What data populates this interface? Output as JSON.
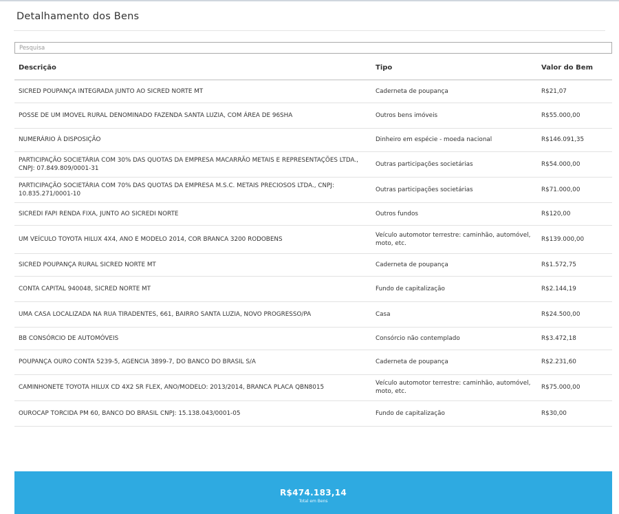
{
  "page": {
    "title": "Detalhamento dos Bens"
  },
  "search": {
    "placeholder": "Pesquisa"
  },
  "table": {
    "headers": [
      "Descrição",
      "Tipo",
      "Valor do Bem"
    ],
    "rows": [
      {
        "descricao": "SICRED POUPANÇA INTEGRADA JUNTO AO SICRED NORTE MT",
        "tipo": "Caderneta de poupança",
        "valor": "R$21,07"
      },
      {
        "descricao": "POSSE DE UM IMOVEL RURAL DENOMINADO FAZENDA SANTA LUZIA, COM ÁREA DE 96SHA",
        "tipo": "Outros bens imóveis",
        "valor": "R$55.000,00"
      },
      {
        "descricao": "NUMERÁRIO À DISPOSIÇÃO",
        "tipo": "Dinheiro em espécie - moeda nacional",
        "valor": "R$146.091,35"
      },
      {
        "descricao": "PARTICIPAÇÃO SOCIETÁRIA COM 30% DAS QUOTAS DA EMPRESA MACARRÃO METAIS E REPRESENTAÇÕES LTDA., CNPJ: 07.849.809/0001-31",
        "tipo": "Outras participações societárias",
        "valor": "R$54.000,00"
      },
      {
        "descricao": "PARTICIPAÇÃO SOCIETÁRIA COM 70% DAS QUOTAS DA EMPRESA M.S.C. METAIS PRECIOSOS LTDA., CNPJ: 10.835.271/0001-10",
        "tipo": "Outras participações societárias",
        "valor": "R$71.000,00"
      },
      {
        "descricao": "SICREDI FAPI RENDA FIXA, JUNTO AO SICREDI NORTE",
        "tipo": "Outros fundos",
        "valor": "R$120,00"
      },
      {
        "descricao": "UM VEÍCULO TOYOTA HILUX 4X4, ANO E MODELO 2014, COR BRANCA 3200 RODOBENS",
        "tipo": "Veículo automotor terrestre: caminhão, automóvel, moto, etc.",
        "valor": "R$139.000,00"
      },
      {
        "descricao": "SICRED POUPANÇA RURAL SICRED NORTE MT",
        "tipo": "Caderneta de poupança",
        "valor": "R$1.572,75"
      },
      {
        "descricao": "CONTA CAPITAL 940048, SICRED NORTE MT",
        "tipo": "Fundo de capitalização",
        "valor": "R$2.144,19"
      },
      {
        "descricao": "UMA CASA LOCALIZADA NA RUA TIRADENTES, 661, BAIRRO SANTA LUZIA, NOVO PROGRESSO/PA",
        "tipo": "Casa",
        "valor": "R$24.500,00"
      },
      {
        "descricao": "BB CONSÓRCIO DE AUTOMÓVEIS",
        "tipo": "Consórcio não contemplado",
        "valor": "R$3.472,18"
      },
      {
        "descricao": "POUPANÇA OURO CONTA 5239-5, AGENCIA 3899-7, DO BANCO DO BRASIL S/A",
        "tipo": "Caderneta de poupança",
        "valor": "R$2.231,60"
      },
      {
        "descricao": "CAMINHONETE TOYOTA HILUX CD 4X2 SR FLEX, ANO/MODELO: 2013/2014, BRANCA PLACA QBN8015",
        "tipo": "Veículo automotor terrestre: caminhão, automóvel, moto, etc.",
        "valor": "R$75.000,00"
      },
      {
        "descricao": "OUROCAP TORCIDA PM 60, BANCO DO BRASIL CNPJ: 15.138.043/0001-05",
        "tipo": "Fundo de capitalização",
        "valor": "R$30,00"
      }
    ]
  },
  "total": {
    "value": "R$474.183,14",
    "label": "Total em Bens"
  },
  "colors": {
    "accent": "#2eaae1"
  }
}
